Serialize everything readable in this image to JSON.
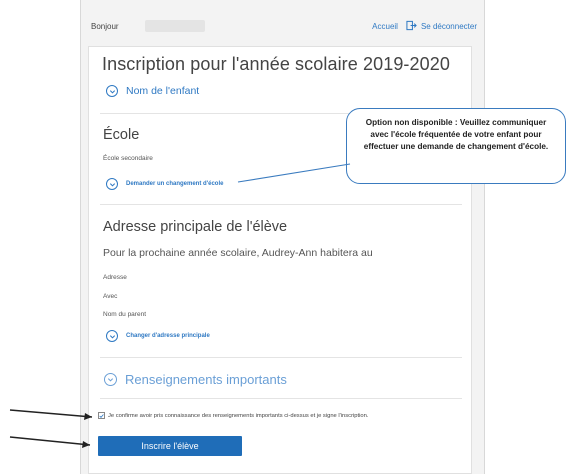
{
  "topbar": {
    "greeting": "Bonjour",
    "home_link": "Accueil",
    "logout_link": "Se déconnecter"
  },
  "page_title": "Inscription pour l'année scolaire 2019-2020",
  "child_section": {
    "label": "Nom de l'enfant"
  },
  "school_section": {
    "heading": "École",
    "school_label": "École secondaire",
    "change_link": "Demander un changement d'école"
  },
  "address_section": {
    "heading": "Adresse principale de l'élève",
    "lead": "Pour la prochaine année scolaire, Audrey-Ann habitera au",
    "address_label": "Adresse",
    "with_label": "Avec",
    "parent_label": "Nom du parent",
    "change_link": "Changer d'adresse principale"
  },
  "important_section": {
    "label": "Renseignements importants"
  },
  "confirm": {
    "checked": true,
    "text": "Je confirme avoir pris connaissance des renseignements importants ci-dessus et je signe l'inscription."
  },
  "submit_button": "Inscrire l'élève",
  "callout": {
    "text": "Option non disponible : Veuillez communiquer avec l'école fréquentée de votre enfant pour effectuer une demande de changement d'école."
  },
  "colors": {
    "link": "#2f79c3",
    "primary": "#1f6db8",
    "callout_border": "#3a7bbf"
  },
  "icons": {
    "logout": "logout-icon",
    "expand": "chevron-down-circle-icon",
    "check": "check-icon"
  }
}
